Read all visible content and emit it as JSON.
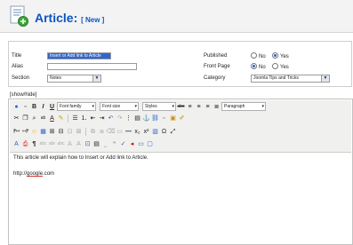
{
  "header": {
    "title": "Article:",
    "mode": "[ New ]"
  },
  "form": {
    "title_label": "Title",
    "title_value": "Insert or Add link to Article",
    "alias_label": "Alias",
    "alias_value": "",
    "section_label": "Section",
    "section_value": "Notes",
    "published_label": "Published",
    "frontpage_label": "Front Page",
    "category_label": "Category",
    "category_value": "Joomla Tips and Tricks",
    "no_label": "No",
    "yes_label": "Yes",
    "published_selected": "yes",
    "frontpage_selected": "no"
  },
  "editor": {
    "showhide": "[show/hide]",
    "font_family": "Font family",
    "font_size": "Font size",
    "styles": "Styles",
    "format": "Paragraph",
    "content_line1": "This article will explain how to Insert or Add link to Article.",
    "content_line2_prefix": "http://",
    "content_line2_word": "google",
    "content_line2_suffix": ".com"
  },
  "colors": {
    "accent": "#0b55c4",
    "selection": "#3366cc"
  },
  "icons": [
    "new-article-icon",
    "help-icon",
    "new-document-icon",
    "bold-icon",
    "italic-icon",
    "underline-icon",
    "undo-icon",
    "redo-icon",
    "list-icon",
    "cut-icon",
    "copy-icon",
    "paste-icon",
    "anchor-icon",
    "link-icon",
    "image-icon",
    "table-icon",
    "horizontal-rule-icon",
    "subscript-icon",
    "superscript-icon",
    "special-char-icon",
    "emoticon-icon",
    "print-icon",
    "fullscreen-icon"
  ]
}
